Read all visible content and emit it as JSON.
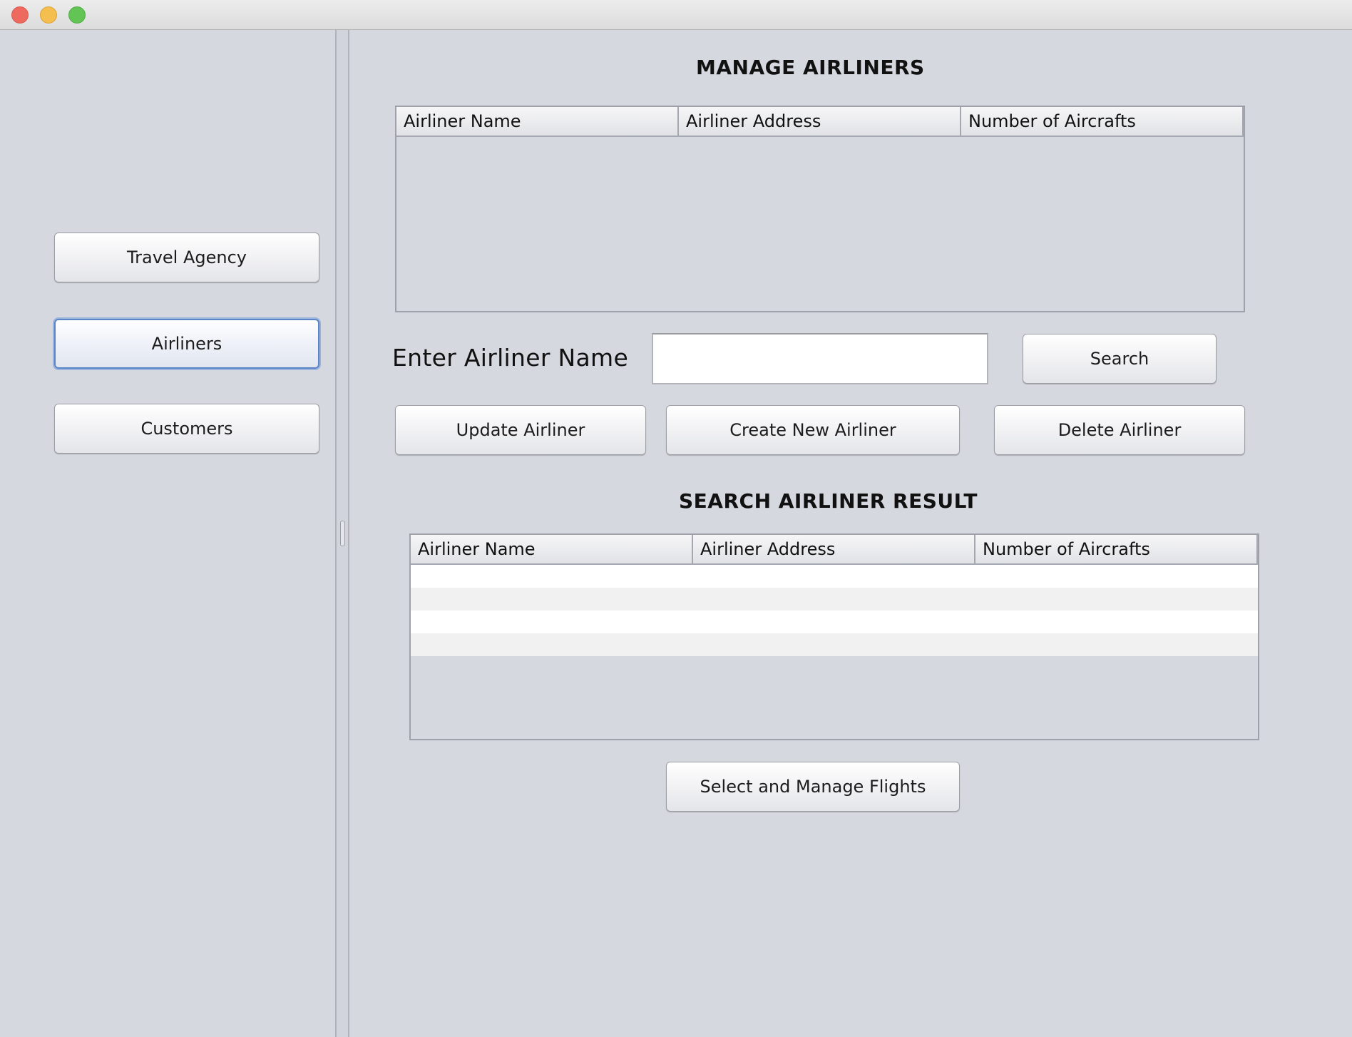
{
  "window": {
    "controls": [
      "close",
      "minimize",
      "maximize"
    ]
  },
  "sidebar": {
    "items": [
      {
        "label": "Travel Agency"
      },
      {
        "label": "Airliners",
        "focused": true
      },
      {
        "label": "Customers"
      }
    ]
  },
  "main": {
    "title": "MANAGE AIRLINERS",
    "airliners_table": {
      "columns": [
        "Airliner Name",
        "Airliner Address",
        "Number of Aircrafts"
      ],
      "rows": []
    },
    "search": {
      "label": "Enter Airliner Name",
      "value": "",
      "placeholder": "",
      "button_label": "Search"
    },
    "actions": {
      "update_label": "Update Airliner",
      "create_label": "Create New Airliner",
      "delete_label": "Delete Airliner"
    },
    "result_title": "SEARCH AIRLINER RESULT",
    "result_table": {
      "columns": [
        "Airliner Name",
        "Airliner Address",
        "Number of Aircrafts"
      ],
      "rows": [
        [
          "",
          "",
          ""
        ],
        [
          "",
          "",
          ""
        ],
        [
          "",
          "",
          ""
        ],
        [
          "",
          "",
          ""
        ]
      ]
    },
    "manage_flights_label": "Select and Manage Flights"
  }
}
